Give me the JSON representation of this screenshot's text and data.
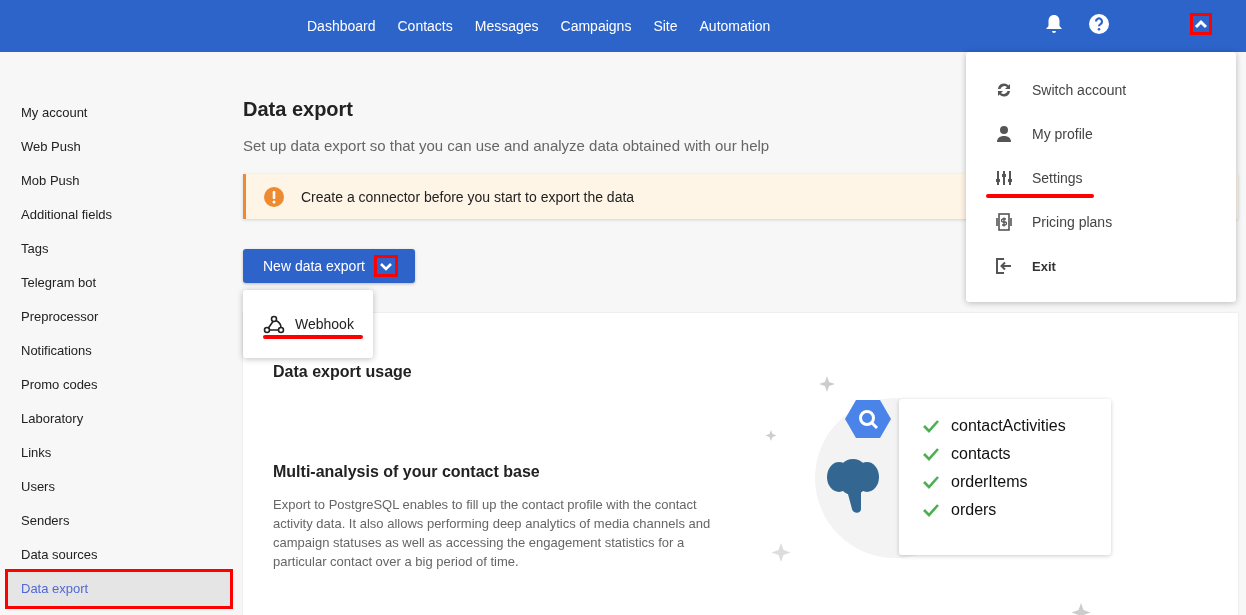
{
  "top_nav": [
    {
      "label": "Dashboard"
    },
    {
      "label": "Contacts"
    },
    {
      "label": "Messages"
    },
    {
      "label": "Campaigns"
    },
    {
      "label": "Site"
    },
    {
      "label": "Automation"
    }
  ],
  "account_toggle": {
    "expanded": true,
    "highlighted": true
  },
  "account_menu": [
    {
      "label": "Switch account",
      "kind": "sync",
      "underlined": false
    },
    {
      "label": "My profile",
      "kind": "person",
      "underlined": false
    },
    {
      "label": "Settings",
      "kind": "sliders",
      "underlined": true
    },
    {
      "label": "Pricing plans",
      "kind": "money",
      "underlined": false
    },
    {
      "label": "Exit",
      "kind": "exit",
      "underlined": false
    }
  ],
  "sidebar": {
    "items": [
      {
        "label": "My account",
        "selected": false
      },
      {
        "label": "Web Push",
        "selected": false
      },
      {
        "label": "Mob Push",
        "selected": false
      },
      {
        "label": "Additional fields",
        "selected": false
      },
      {
        "label": "Tags",
        "selected": false
      },
      {
        "label": "Telegram bot",
        "selected": false
      },
      {
        "label": "Preprocessor",
        "selected": false
      },
      {
        "label": "Notifications",
        "selected": false
      },
      {
        "label": "Promo codes",
        "selected": false
      },
      {
        "label": "Laboratory",
        "selected": false
      },
      {
        "label": "Links",
        "selected": false
      },
      {
        "label": "Users",
        "selected": false
      },
      {
        "label": "Senders",
        "selected": false
      },
      {
        "label": "Data sources",
        "selected": false
      },
      {
        "label": "Data export",
        "selected": true,
        "highlighted": true
      }
    ]
  },
  "page": {
    "title": "Data export",
    "subtitle": "Set up data export so that you can use and analyze data obtained with our help"
  },
  "alert": {
    "text": "Create a connector before you start to export the data"
  },
  "new_export_button": {
    "label": "New data export",
    "expanded": true,
    "caret_highlighted": true
  },
  "export_menu": [
    {
      "label": "Webhook",
      "underlined": true
    }
  ],
  "usage_card": {
    "title": "Data export usage",
    "heading": "Multi-analysis of your contact base",
    "text": "Export to PostgreSQL enables to fill up the contact profile with the contact activity data. It also allows performing deep analytics of media channels and campaign statuses as well as accessing the engagement statistics for a particular contact over a big period of time.",
    "tables": [
      {
        "label": "contactActivities",
        "checked": true
      },
      {
        "label": "contacts",
        "checked": true
      },
      {
        "label": "orderItems",
        "checked": true
      },
      {
        "label": "orders",
        "checked": true
      }
    ]
  }
}
